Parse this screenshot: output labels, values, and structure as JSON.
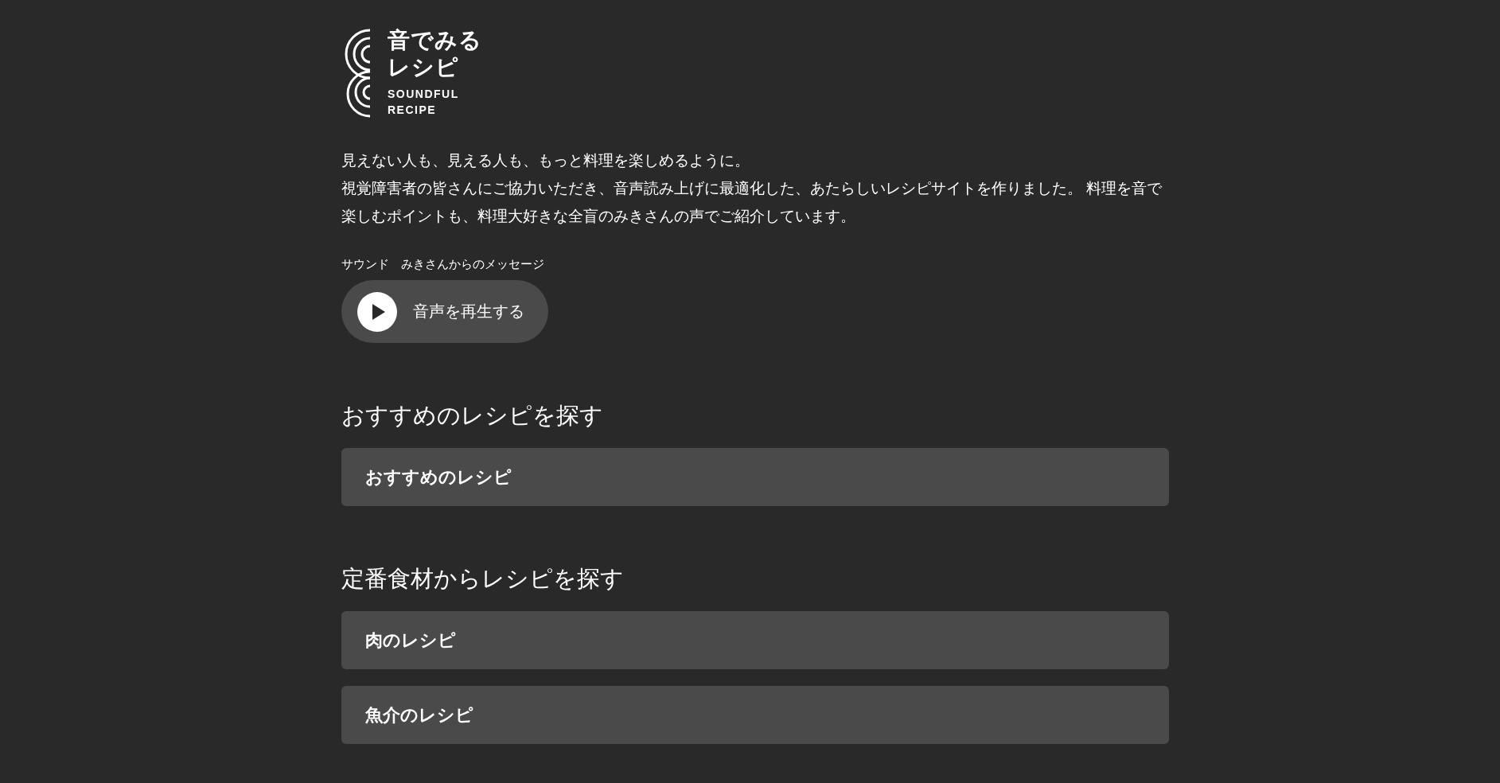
{
  "logo": {
    "title_lines": [
      "音でみる",
      "レシピ"
    ],
    "subtitle_lines": [
      "SOUNDFUL",
      "RECIPE"
    ]
  },
  "intro": {
    "lead": "見えない人も、見える人も、もっと料理を楽しめるように。",
    "description": "視覚障害者の皆さんにご協力いただき、音声読み上げに最適化した、あたらしいレシピサイトを作りました。 料理を音で楽しむポイントも、料理大好きな全盲のみきさんの声でご紹介しています。"
  },
  "sound": {
    "label": "サウンド　みきさんからのメッセージ",
    "button": "音声を再生する"
  },
  "sections": [
    {
      "heading": "おすすめのレシピを探す",
      "items": [
        "おすすめのレシピ"
      ]
    },
    {
      "heading": "定番食材からレシピを探す",
      "items": [
        "肉のレシピ",
        "魚介のレシピ"
      ]
    }
  ]
}
